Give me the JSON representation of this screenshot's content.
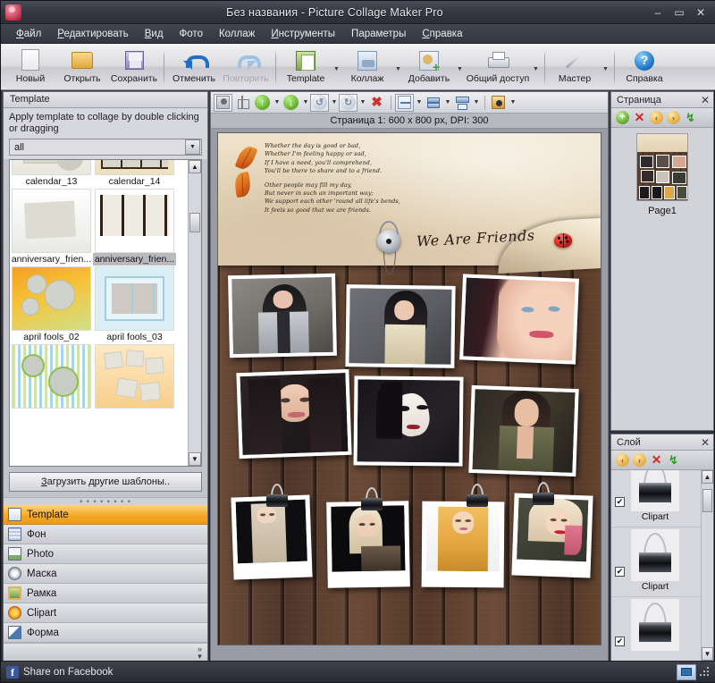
{
  "window": {
    "title": "Без названия - Picture Collage Maker Pro",
    "app_icon": "palette-icon",
    "minimize": "–",
    "maximize": "▭",
    "close": "✕"
  },
  "menubar": [
    {
      "label": "Файл",
      "accel": "Ф"
    },
    {
      "label": "Редактировать",
      "accel": "Р"
    },
    {
      "label": "Вид",
      "accel": "В"
    },
    {
      "label": "Фото",
      "accel": ""
    },
    {
      "label": "Коллаж",
      "accel": ""
    },
    {
      "label": "Инструменты",
      "accel": "И"
    },
    {
      "label": "Параметры",
      "accel": ""
    },
    {
      "label": "Справка",
      "accel": "С"
    }
  ],
  "toolbar": [
    {
      "label": "Новый",
      "icon": "new-document-icon",
      "dropdown": false,
      "disabled": false
    },
    {
      "label": "Открыть",
      "icon": "open-folder-icon",
      "dropdown": false,
      "disabled": false
    },
    {
      "label": "Сохранить",
      "icon": "save-floppy-icon",
      "dropdown": false,
      "disabled": false
    },
    {
      "label": "Отменить",
      "icon": "undo-arrow-icon",
      "dropdown": false,
      "disabled": false
    },
    {
      "label": "Повторить",
      "icon": "redo-arrow-icon",
      "dropdown": false,
      "disabled": true
    },
    {
      "label": "Template",
      "icon": "template-icon",
      "dropdown": true,
      "disabled": false
    },
    {
      "label": "Коллаж",
      "icon": "collage-icon",
      "dropdown": true,
      "disabled": false
    },
    {
      "label": "Добавить",
      "icon": "add-photo-icon",
      "dropdown": true,
      "disabled": false
    },
    {
      "label": "Общий доступ",
      "icon": "print-share-icon",
      "dropdown": true,
      "disabled": false
    },
    {
      "label": "Мастер",
      "icon": "wizard-wand-icon",
      "dropdown": true,
      "disabled": false
    },
    {
      "label": "Справка",
      "icon": "help-circle-icon",
      "dropdown": false,
      "disabled": false
    }
  ],
  "left_panel": {
    "header": "Template",
    "hint": "Apply template to collage by double clicking or dragging",
    "filter": {
      "value": "all",
      "dropdown_icon": "chevron-down-icon"
    },
    "templates": [
      {
        "name": "calendar_13",
        "art": "th-cal13",
        "selected": false
      },
      {
        "name": "calendar_14",
        "art": "th-cal14",
        "selected": false
      },
      {
        "name": "anniversary_frien...",
        "art": "th-ann1",
        "selected": false
      },
      {
        "name": "anniversary_frien...",
        "art": "th-ann2",
        "selected": true
      },
      {
        "name": "april fools_02",
        "art": "th-af02",
        "selected": false
      },
      {
        "name": "april fools_03",
        "art": "th-af03",
        "selected": false
      },
      {
        "name": "",
        "art": "th-str",
        "selected": false
      },
      {
        "name": "",
        "art": "th-or",
        "selected": false
      }
    ],
    "load_more_button": "Загрузить другие шаблоны..",
    "load_more_accel": "З",
    "scroll_up_icon": "chevron-up-icon",
    "scroll_down_icon": "chevron-down-icon",
    "categories": [
      {
        "label": "Template",
        "icon": "template-swatch-icon",
        "icon_class": "ic-template",
        "active": true
      },
      {
        "label": "Фон",
        "icon": "background-swatch-icon",
        "icon_class": "ic-back",
        "active": false
      },
      {
        "label": "Photo",
        "icon": "photo-swatch-icon",
        "icon_class": "ic-photo",
        "active": false
      },
      {
        "label": "Маска",
        "icon": "mask-swatch-icon",
        "icon_class": "ic-mask",
        "active": false
      },
      {
        "label": "Рамка",
        "icon": "frame-swatch-icon",
        "icon_class": "ic-frame",
        "active": false
      },
      {
        "label": "Clipart",
        "icon": "clipart-swatch-icon",
        "icon_class": "ic-clipart",
        "active": false
      },
      {
        "label": "Форма",
        "icon": "shape-swatch-icon",
        "icon_class": "ic-shape",
        "active": false
      }
    ],
    "more_chevron": "»"
  },
  "canvas": {
    "toolbar": [
      {
        "name": "mask-tool-icon",
        "class": "cti-person",
        "framed": true,
        "dropdown": false
      },
      {
        "name": "crop-tool-icon",
        "class": "cti-crop",
        "framed": false,
        "dropdown": false
      },
      {
        "name": "move-up-icon",
        "class": "circ green",
        "glyph": "↑",
        "framed": false,
        "dropdown": true
      },
      {
        "name": "move-down-icon",
        "class": "circ green",
        "glyph": "↓",
        "framed": false,
        "dropdown": true
      },
      {
        "name": "rotate-left-icon",
        "class": "circ pale",
        "glyph": "↺",
        "framed": true,
        "dropdown": true
      },
      {
        "name": "rotate-right-icon",
        "class": "circ pale",
        "glyph": "↻",
        "framed": true,
        "dropdown": true
      },
      {
        "name": "delete-icon",
        "class": "xmark",
        "glyph": "✖",
        "framed": false,
        "dropdown": false
      },
      {
        "name": "align-center-icon",
        "class": "cti-align1",
        "framed": true,
        "dropdown": true
      },
      {
        "name": "align-left-icon",
        "class": "cti-align2",
        "framed": false,
        "dropdown": true
      },
      {
        "name": "distribute-icon",
        "class": "cti-align3",
        "framed": false,
        "dropdown": true
      },
      {
        "name": "effects-icon",
        "class": "cti-pic",
        "framed": false,
        "dropdown": true
      }
    ],
    "page_info": "Страница 1: 600 x 800 px, DPI: 300"
  },
  "collage": {
    "poem": [
      "Whether the day is good or bad,\nWhether I'm feeling happy or sad,\nIf I have a need, you'll comprehend,\nYou'll be there to share and to a friend.",
      "Other people may fill my day,\nBut never in such an important way;\nWe support each other 'round all life's bends,\nIt feels so good that we are friends."
    ],
    "signature": "We Are Friends",
    "decorations": [
      {
        "name": "leaf-clipart",
        "count": 2
      },
      {
        "name": "ladybug-clipart",
        "count": 1
      },
      {
        "name": "hook-clipart",
        "count": 1
      },
      {
        "name": "binder-clip-clipart",
        "count": 4
      }
    ],
    "photos": [
      {
        "slot": "top-row-1",
        "tone": "dark-hair-portrait"
      },
      {
        "slot": "top-row-2",
        "tone": "grey-studio-portrait"
      },
      {
        "slot": "top-row-3",
        "tone": "closeup-freckles-portrait"
      },
      {
        "slot": "mid-row-1",
        "tone": "smoky-eye-portrait"
      },
      {
        "slot": "mid-row-2",
        "tone": "pale-gothic-portrait"
      },
      {
        "slot": "mid-row-3",
        "tone": "olive-top-portrait"
      },
      {
        "slot": "bottom-row-1",
        "tone": "blonde-long-hair"
      },
      {
        "slot": "bottom-row-2",
        "tone": "blonde-fur-collar"
      },
      {
        "slot": "bottom-row-3",
        "tone": "golden-curls"
      },
      {
        "slot": "bottom-row-4",
        "tone": "red-lips-blonde"
      }
    ]
  },
  "page_panel": {
    "header": "Страница",
    "close_icon": "close-icon",
    "tools": [
      {
        "name": "add-page-icon",
        "glyph": "+",
        "class": "ico-plus"
      },
      {
        "name": "delete-page-icon",
        "glyph": "✕",
        "class": "ico-x"
      },
      {
        "name": "move-page-left-icon",
        "glyph": "‹",
        "class": "ico-pause"
      },
      {
        "name": "move-page-right-icon",
        "glyph": "›",
        "class": "ico-pause"
      },
      {
        "name": "refresh-page-icon",
        "glyph": "↯",
        "class": "ico-refresh"
      }
    ],
    "pages": [
      {
        "label": "Page1"
      }
    ]
  },
  "layer_panel": {
    "header": "Слой",
    "close_icon": "close-icon",
    "tools": [
      {
        "name": "layer-up-icon",
        "glyph": "‹",
        "class": "ico-pause"
      },
      {
        "name": "layer-down-icon",
        "glyph": "›",
        "class": "ico-pause"
      },
      {
        "name": "delete-layer-icon",
        "glyph": "✕",
        "class": "ico-x"
      },
      {
        "name": "refresh-layers-icon",
        "glyph": "↯",
        "class": "ico-refresh"
      }
    ],
    "layers": [
      {
        "name": "Clipart",
        "checked": true,
        "check_glyph": "✔"
      },
      {
        "name": "Clipart",
        "checked": true,
        "check_glyph": "✔"
      },
      {
        "name": "",
        "checked": true,
        "check_glyph": "✔"
      }
    ],
    "scroll_up_icon": "chevron-up-icon",
    "scroll_down_icon": "chevron-down-icon"
  },
  "statusbar": {
    "facebook_icon": "facebook-icon",
    "facebook_glyph": "f",
    "share_label": "Share on Facebook",
    "monitor_icon": "monitor-icon",
    "resize_grip": "resize-grip-icon"
  },
  "colors": {
    "accent_orange": "#f5a623",
    "titlebar": "#383b45",
    "panel": "#c3c4ca",
    "canvas_bg": "#9a9ca5"
  }
}
